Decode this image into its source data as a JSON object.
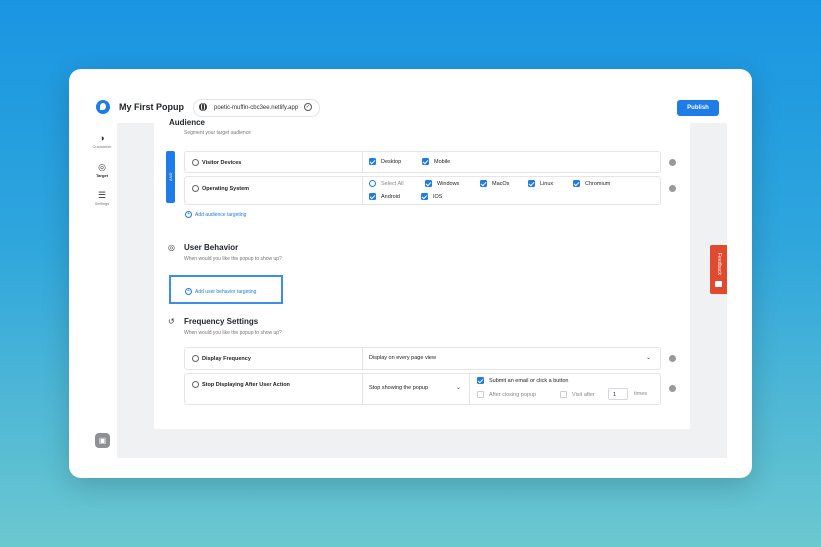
{
  "app": {
    "title": "My First Popup",
    "url": "poetic-muffin-cbc3ee.netlify.app",
    "publish_label": "Publish"
  },
  "sidebar": {
    "items": [
      {
        "label": "Customize",
        "icon": "contrast-icon"
      },
      {
        "label": "Target",
        "icon": "target-icon"
      },
      {
        "label": "Settings",
        "icon": "sliders-icon"
      }
    ]
  },
  "audience": {
    "title": "Audience",
    "subtitle": "Segment your target audience",
    "and_label": "AND",
    "visitor_devices": {
      "label": "Visitor Devices",
      "options": [
        "Desktop",
        "Mobile"
      ]
    },
    "operating_system": {
      "label": "Operating System",
      "select_all": "Select All",
      "options": [
        "Windows",
        "MacOs",
        "Linux",
        "Chromium",
        "Android",
        "IOS"
      ]
    },
    "add_link": "Add audience targeting"
  },
  "user_behavior": {
    "title": "User Behavior",
    "subtitle": "When would you like the popup to show up?",
    "add_link": "Add user behavior targeting"
  },
  "frequency": {
    "title": "Frequency Settings",
    "subtitle": "When would you like the popup to show up?",
    "display_frequency": {
      "label": "Display Frequency",
      "value": "Display on every page view"
    },
    "stop_displaying": {
      "label": "Stop Displaying After User Action",
      "value": "Stop showing the popup",
      "opt_submit": "Submit an email or click a button",
      "opt_after_closing": "After closing popup",
      "opt_visit_after": "Visit after",
      "visit_count": "1",
      "times_label": "times"
    }
  },
  "feedback": {
    "label": "Feedback"
  },
  "colors": {
    "accent": "#1e7ce8",
    "feedback": "#e04a2f"
  }
}
